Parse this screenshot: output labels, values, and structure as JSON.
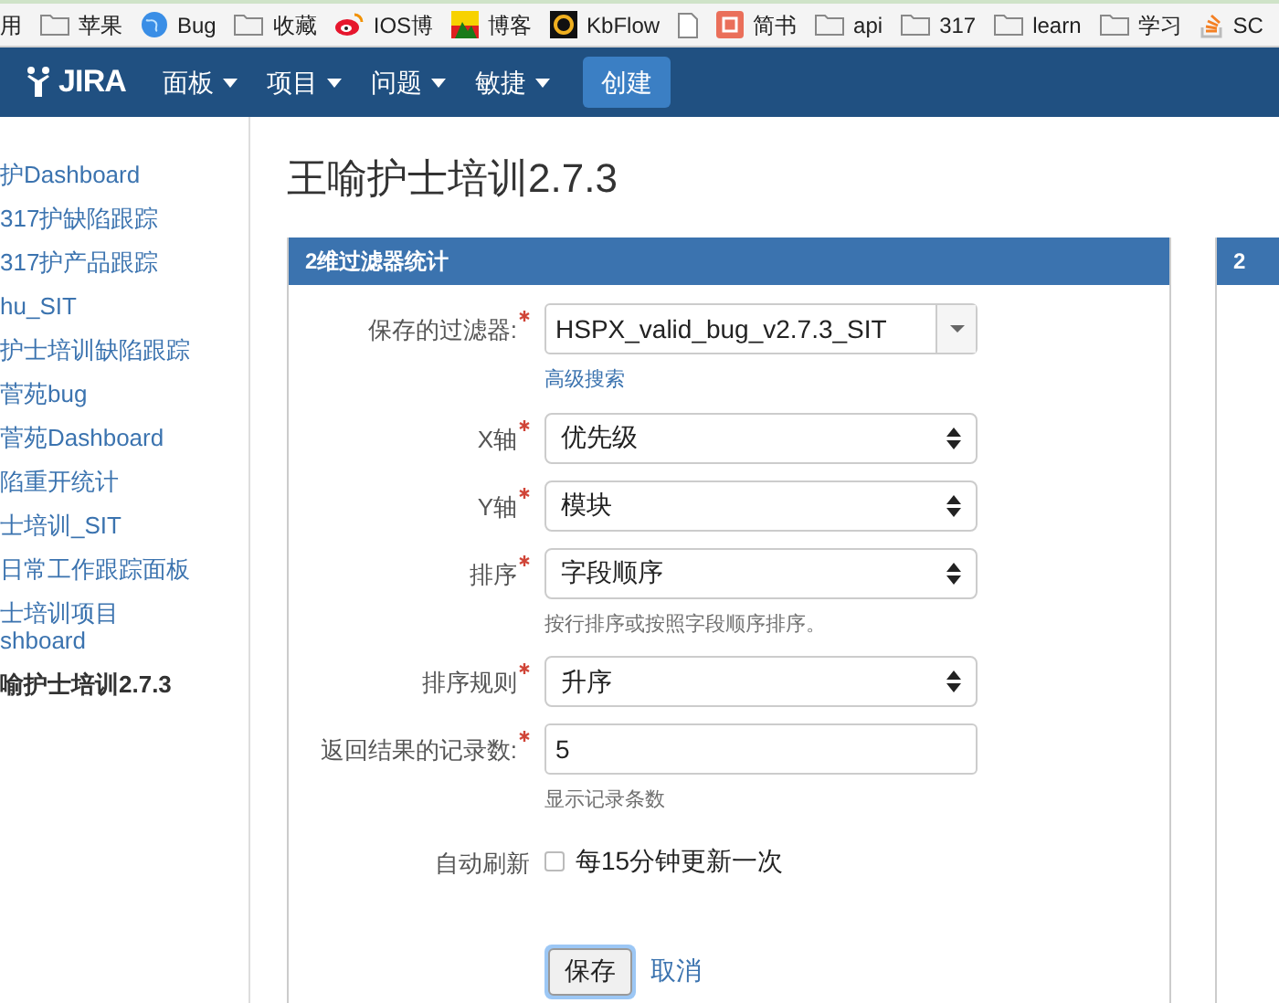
{
  "bookmarks": [
    {
      "kind": "plain",
      "label": "用"
    },
    {
      "kind": "folder",
      "label": "苹果"
    },
    {
      "kind": "globe",
      "label": "Bug"
    },
    {
      "kind": "folder",
      "label": "收藏"
    },
    {
      "kind": "weibo",
      "label": "IOS博"
    },
    {
      "kind": "image",
      "label": "博客"
    },
    {
      "kind": "kbflow",
      "label": "KbFlow"
    },
    {
      "kind": "file"
    },
    {
      "kind": "jianshu",
      "label": "简书"
    },
    {
      "kind": "folder",
      "label": "api"
    },
    {
      "kind": "folder",
      "label": "317"
    },
    {
      "kind": "folder",
      "label": "learn"
    },
    {
      "kind": "folder",
      "label": "学习"
    },
    {
      "kind": "stack",
      "label": "SC"
    }
  ],
  "nav": {
    "logo": "JIRA",
    "menus": [
      "面板",
      "项目",
      "问题",
      "敏捷"
    ],
    "create_button": "创建"
  },
  "sidebar": {
    "items": [
      {
        "label": "护Dashboard",
        "selected": false
      },
      {
        "label": "317护缺陷跟踪",
        "selected": false
      },
      {
        "label": "317护产品跟踪",
        "selected": false
      },
      {
        "label": "hu_SIT",
        "selected": false
      },
      {
        "label": "护士培训缺陷跟踪",
        "selected": false
      },
      {
        "label": "菅苑bug",
        "selected": false
      },
      {
        "label": "菅苑Dashboard",
        "selected": false
      },
      {
        "label": "陷重开统计",
        "selected": false
      },
      {
        "label": "士培训_SIT",
        "selected": false
      },
      {
        "label": "日常工作跟踪面板",
        "selected": false
      },
      {
        "label": "士培训项目\nshboard",
        "selected": false
      },
      {
        "label": "喻护士培训2.7.3",
        "selected": true
      }
    ]
  },
  "page_title": "王喻护士培训2.7.3",
  "panel": {
    "title": "2维过滤器统计",
    "fields": [
      {
        "kind": "combo",
        "label": "保存的过滤器:",
        "required": true,
        "value": "HSPX_valid_bug_v2.7.3_SIT",
        "link": "高级搜索"
      },
      {
        "kind": "select",
        "label": "X轴",
        "required": true,
        "value": "优先级"
      },
      {
        "kind": "select",
        "label": "Y轴",
        "required": true,
        "value": "模块"
      },
      {
        "kind": "select",
        "label": "排序",
        "required": true,
        "value": "字段顺序",
        "hint": "按行排序或按照字段顺序排序。"
      },
      {
        "kind": "select",
        "label": "排序规则",
        "required": true,
        "value": "升序"
      },
      {
        "kind": "text",
        "label": "返回结果的记录数:",
        "required": true,
        "value": "5",
        "hint": "显示记录条数"
      },
      {
        "kind": "checkbox",
        "label": "自动刷新",
        "option": "每15分钟更新一次",
        "checked": false
      }
    ],
    "save_button": "保存",
    "cancel_link": "取消"
  },
  "second_panel": {
    "title": "2"
  }
}
